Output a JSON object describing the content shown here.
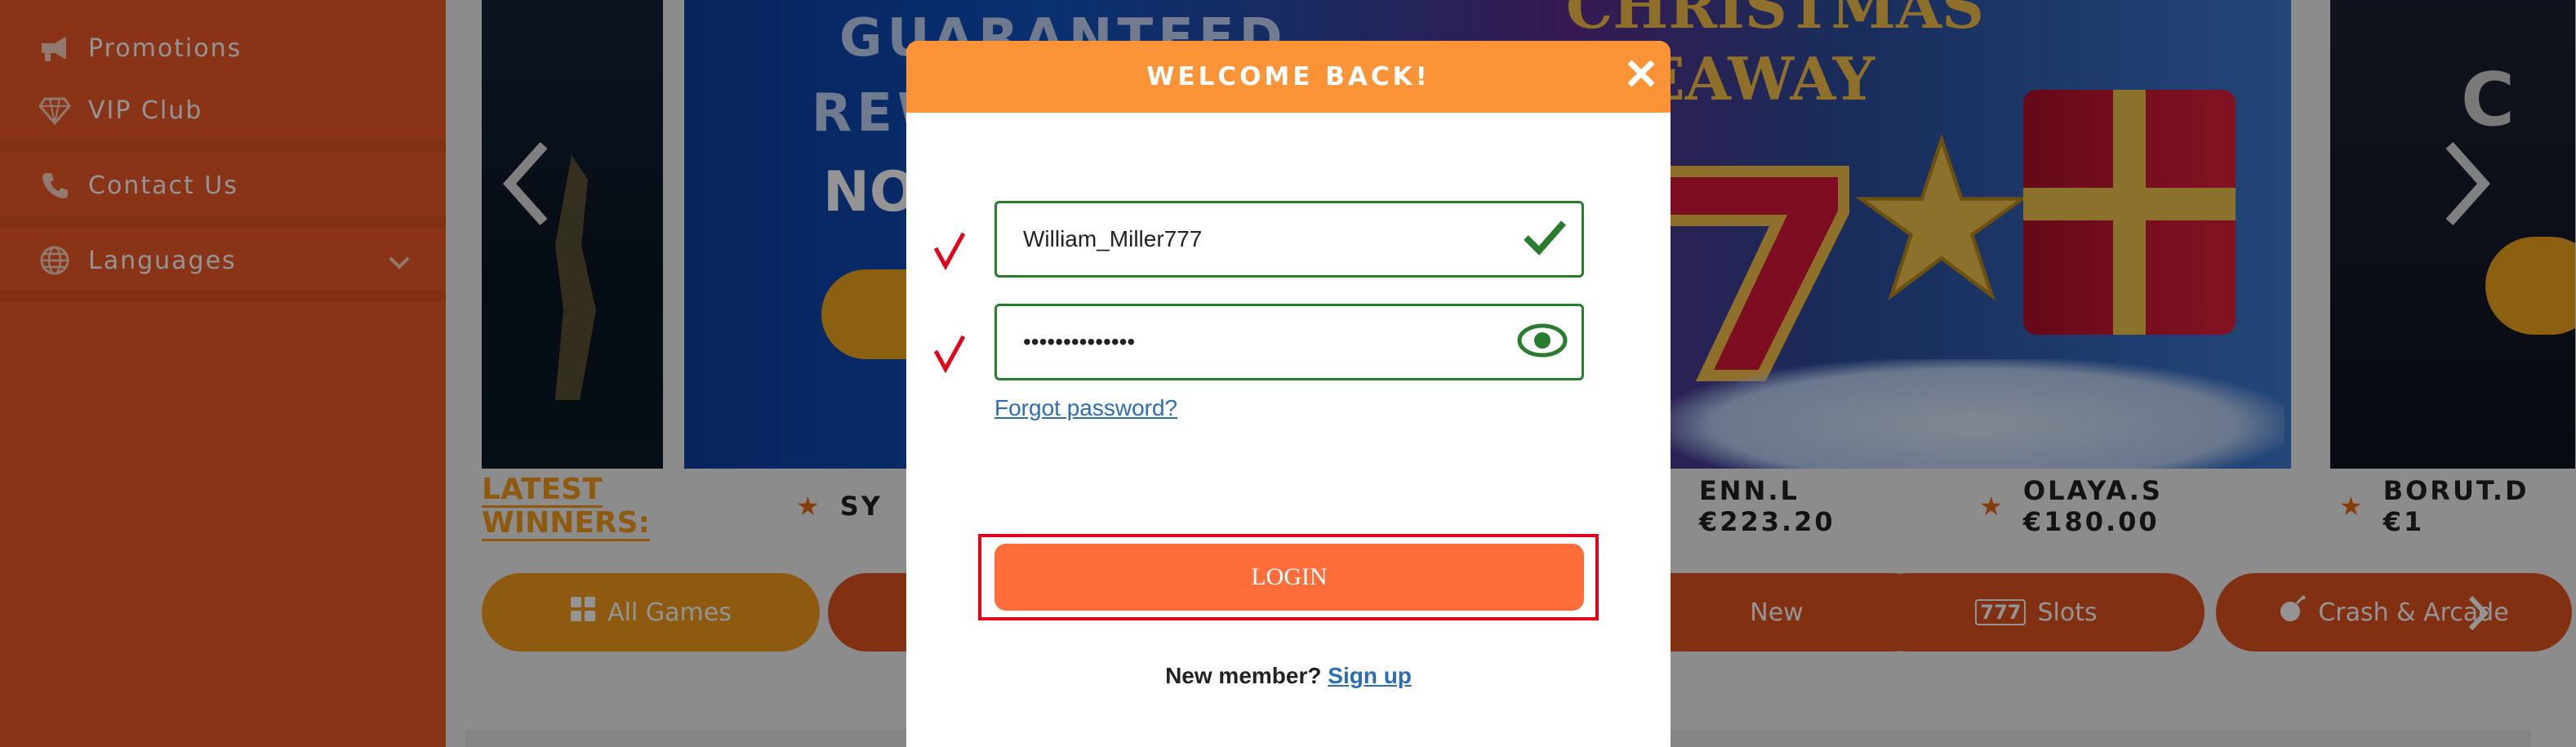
{
  "sidebar": {
    "items": [
      {
        "label": "Promotions",
        "icon": "megaphone-icon"
      },
      {
        "label": "VIP Club",
        "icon": "diamond-icon"
      },
      {
        "label": "Contact Us",
        "icon": "phone-icon"
      },
      {
        "label": "Languages",
        "icon": "globe-icon"
      }
    ]
  },
  "banner": {
    "left_text": {
      "line1": "GUARANTEED",
      "line2": "REW",
      "line3": "NO"
    },
    "promo_title": {
      "line1": "CHRISTMAS",
      "line2": "GIVEAWAY"
    }
  },
  "winners": {
    "label": "LATEST WINNERS:",
    "cut_left": "SY",
    "entries": [
      {
        "text": "ENN.L €223.20"
      },
      {
        "text": "OLAYA.S €180.00"
      },
      {
        "text": "BORUT.D €1"
      }
    ]
  },
  "categories": [
    {
      "label": "All Games",
      "icon": "grid-icon"
    },
    {
      "label": "New",
      "icon": "new-icon"
    },
    {
      "label": "Slots",
      "icon": "slots-777-icon"
    },
    {
      "label": "Crash & Arcade",
      "icon": "bomb-icon"
    }
  ],
  "modal": {
    "title": "WELCOME BACK!",
    "username_value": "William_Miller777",
    "password_value": "••••••••••••••",
    "forgot_label": "Forgot password?",
    "login_label": "LOGIN",
    "new_member_text": "New member?",
    "signup_label": "Sign up"
  },
  "colors": {
    "sidebar_bg": "#ec5a28",
    "modal_header": "#fd9337",
    "login_button": "#fe6d3a",
    "valid_green": "#2a7d2e",
    "highlight_red": "#e1051b"
  }
}
